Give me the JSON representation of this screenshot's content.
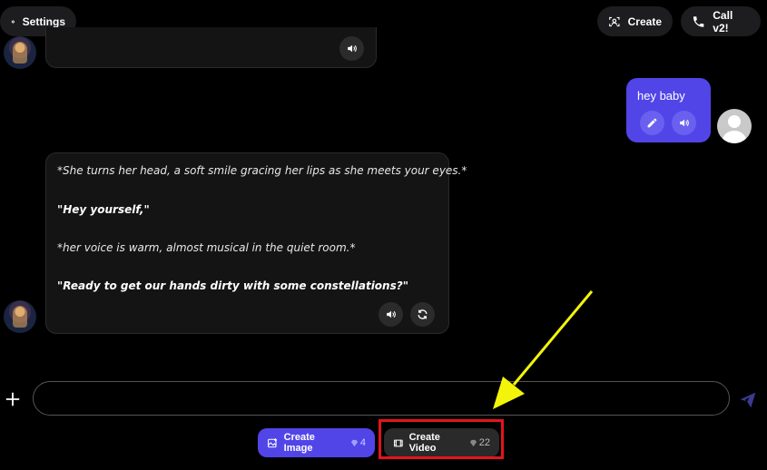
{
  "header": {
    "settings_label": "Settings",
    "create_label": "Create",
    "call_label": "Call v2!"
  },
  "messages": {
    "ai_reply_lines": [
      "*She turns her head, a soft smile gracing her lips as she meets your eyes.*",
      "\"Hey yourself,\"",
      "*her voice is warm, almost musical in the quiet room.*",
      "\"Ready to get our hands dirty with some constellations?\""
    ],
    "user_message": "hey baby"
  },
  "composer": {
    "input_value": "",
    "placeholder": ""
  },
  "actions": {
    "create_image_label": "Create Image",
    "create_image_cost": "4",
    "create_video_label": "Create Video",
    "create_video_cost": "22"
  },
  "colors": {
    "accent": "#5145e8",
    "highlight": "#e3141a",
    "arrow": "#f4f40a"
  },
  "icons": [
    "gear-icon",
    "person-frame-icon",
    "phone-icon",
    "speaker-icon",
    "pencil-icon",
    "refresh-icon",
    "plus-icon",
    "send-icon",
    "image-plus-icon",
    "film-icon",
    "gem-icon"
  ]
}
